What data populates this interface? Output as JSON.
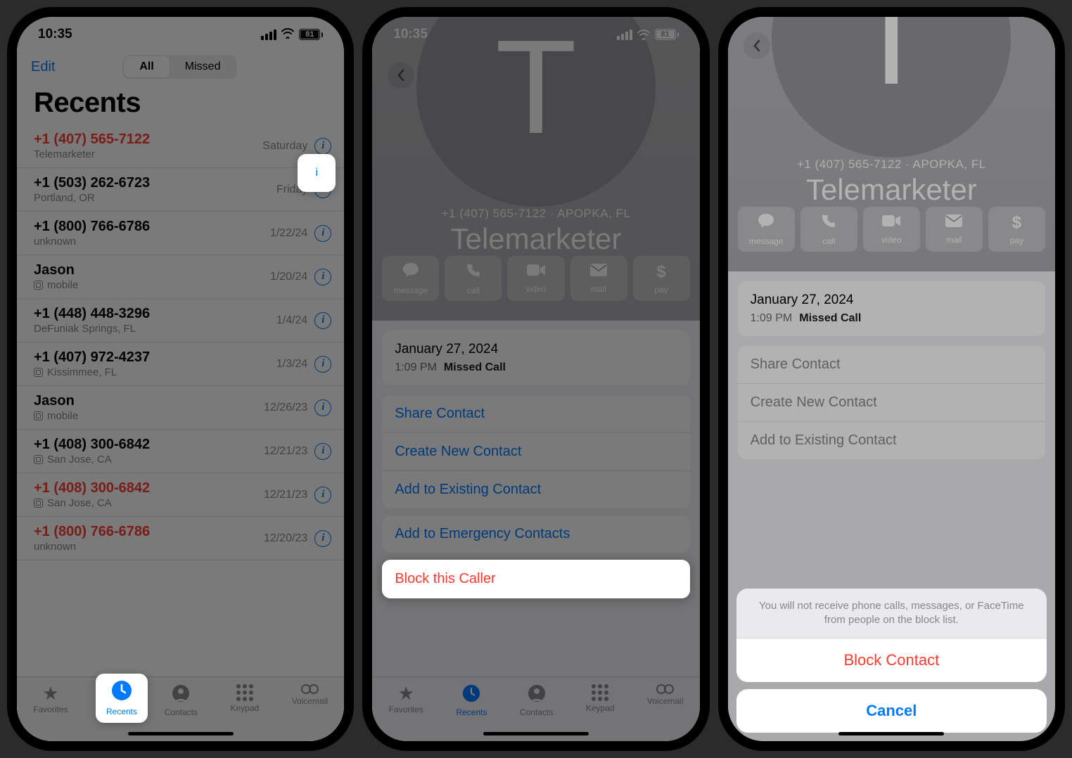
{
  "status": {
    "time": "10:35",
    "battery": "81"
  },
  "screen1": {
    "edit": "Edit",
    "seg": [
      "All",
      "Missed"
    ],
    "title": "Recents",
    "rows": [
      {
        "num": "+1 (407) 565-7122",
        "sub": "Telemarketer",
        "date": "Saturday",
        "miss": true,
        "icon": false
      },
      {
        "num": "+1 (503) 262-6723",
        "sub": "Portland, OR",
        "date": "Friday",
        "miss": false,
        "icon": false
      },
      {
        "num": "+1 (800) 766-6786",
        "sub": "unknown",
        "date": "1/22/24",
        "miss": false,
        "icon": false
      },
      {
        "num": "Jason",
        "sub": "mobile",
        "date": "1/20/24",
        "miss": false,
        "icon": true
      },
      {
        "num": "+1 (448) 448-3296",
        "sub": "DeFuniak Springs, FL",
        "date": "1/4/24",
        "miss": false,
        "icon": false
      },
      {
        "num": "+1 (407) 972-4237",
        "sub": "Kissimmee, FL",
        "date": "1/3/24",
        "miss": false,
        "icon": true
      },
      {
        "num": "Jason",
        "sub": "mobile",
        "date": "12/26/23",
        "miss": false,
        "icon": true
      },
      {
        "num": "+1 (408) 300-6842",
        "sub": "San Jose, CA",
        "date": "12/21/23",
        "miss": false,
        "icon": true
      },
      {
        "num": "+1 (408) 300-6842",
        "sub": "San Jose, CA",
        "date": "12/21/23",
        "miss": true,
        "icon": true
      },
      {
        "num": "+1 (800) 766-6786",
        "sub": "unknown",
        "date": "12/20/23",
        "miss": true,
        "icon": false
      }
    ],
    "tabs": [
      "Favorites",
      "Recents",
      "Contacts",
      "Keypad",
      "Voicemail"
    ]
  },
  "contact": {
    "initial": "T",
    "subline": "+1 (407) 565-7122 · APOPKA, FL",
    "name": "Telemarketer",
    "actions": [
      {
        "icon": "💬",
        "label": "message"
      },
      {
        "icon": "📞",
        "label": "call"
      },
      {
        "icon": "■",
        "label": "video"
      },
      {
        "icon": "✉",
        "label": "mail"
      },
      {
        "icon": "$",
        "label": "pay"
      }
    ],
    "date": "January 27, 2024",
    "call_time": "1:09 PM",
    "call_type": "Missed Call",
    "links": [
      "Share Contact",
      "Create New Contact",
      "Add to Existing Contact"
    ],
    "emergency": "Add to Emergency Contacts",
    "block": "Block this Caller"
  },
  "sheet": {
    "msg": "You will not receive phone calls, messages, or FaceTime from people on the block list.",
    "block": "Block Contact",
    "cancel": "Cancel"
  }
}
